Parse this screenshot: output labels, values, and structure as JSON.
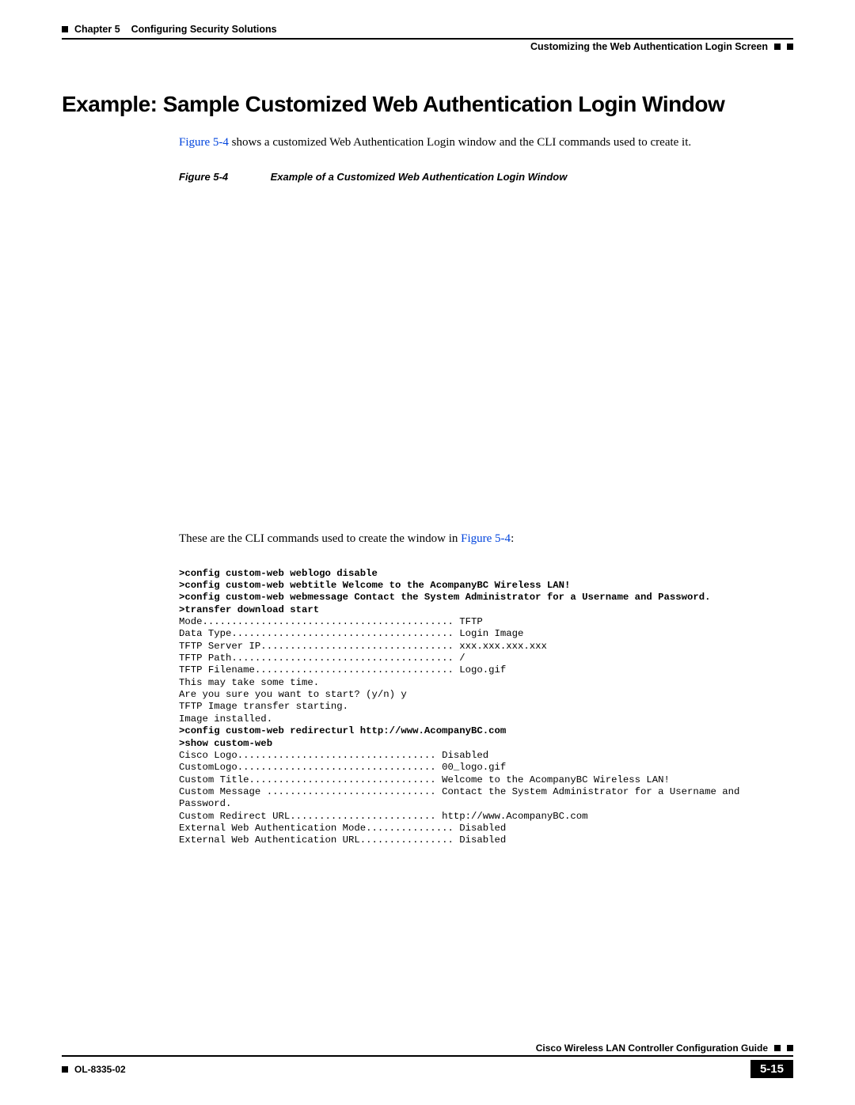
{
  "header": {
    "chapter_label": "Chapter 5",
    "chapter_title": "Configuring Security Solutions",
    "section_title": "Customizing the Web Authentication Login Screen"
  },
  "heading": "Example: Sample Customized Web Authentication Login Window",
  "intro": {
    "link": "Figure 5-4",
    "rest": " shows a customized Web Authentication Login window and the CLI commands used to create it."
  },
  "figure": {
    "label": "Figure 5-4",
    "caption": "Example of a Customized Web Authentication Login Window"
  },
  "cli_intro": {
    "text_before": "These are the CLI commands used to create the window in ",
    "link": "Figure 5-4",
    "text_after": ":"
  },
  "cli": {
    "cmd1": ">config custom-web weblogo disable",
    "cmd2": ">config custom-web webtitle Welcome to the AcompanyBC Wireless LAN!",
    "cmd3": ">config custom-web webmessage Contact the System Administrator for a Username and Password.",
    "cmd4": ">transfer download start",
    "out1": "Mode........................................... TFTP",
    "out2": "Data Type...................................... Login Image",
    "out3": "TFTP Server IP................................. xxx.xxx.xxx.xxx",
    "out4": "TFTP Path...................................... /",
    "out5": "TFTP Filename.................................. Logo.gif",
    "out6": "This may take some time.",
    "out7": "Are you sure you want to start? (y/n) y",
    "out8": "TFTP Image transfer starting.",
    "out9": "Image installed.",
    "cmd5": ">config custom-web redirecturl http://www.AcompanyBC.com",
    "cmd6": ">show custom-web",
    "out10": "Cisco Logo.................................. Disabled",
    "out11": "CustomLogo.................................. 00_logo.gif",
    "out12": "Custom Title................................ Welcome to the AcompanyBC Wireless LAN!",
    "out13": "Custom Message ............................. Contact the System Administrator for a Username and Password.",
    "out14": "Custom Redirect URL......................... http://www.AcompanyBC.com",
    "out15": "External Web Authentication Mode............... Disabled",
    "out16": "External Web Authentication URL................ Disabled"
  },
  "footer": {
    "guide": "Cisco Wireless LAN Controller Configuration Guide",
    "docid": "OL-8335-02",
    "page": "5-15"
  }
}
